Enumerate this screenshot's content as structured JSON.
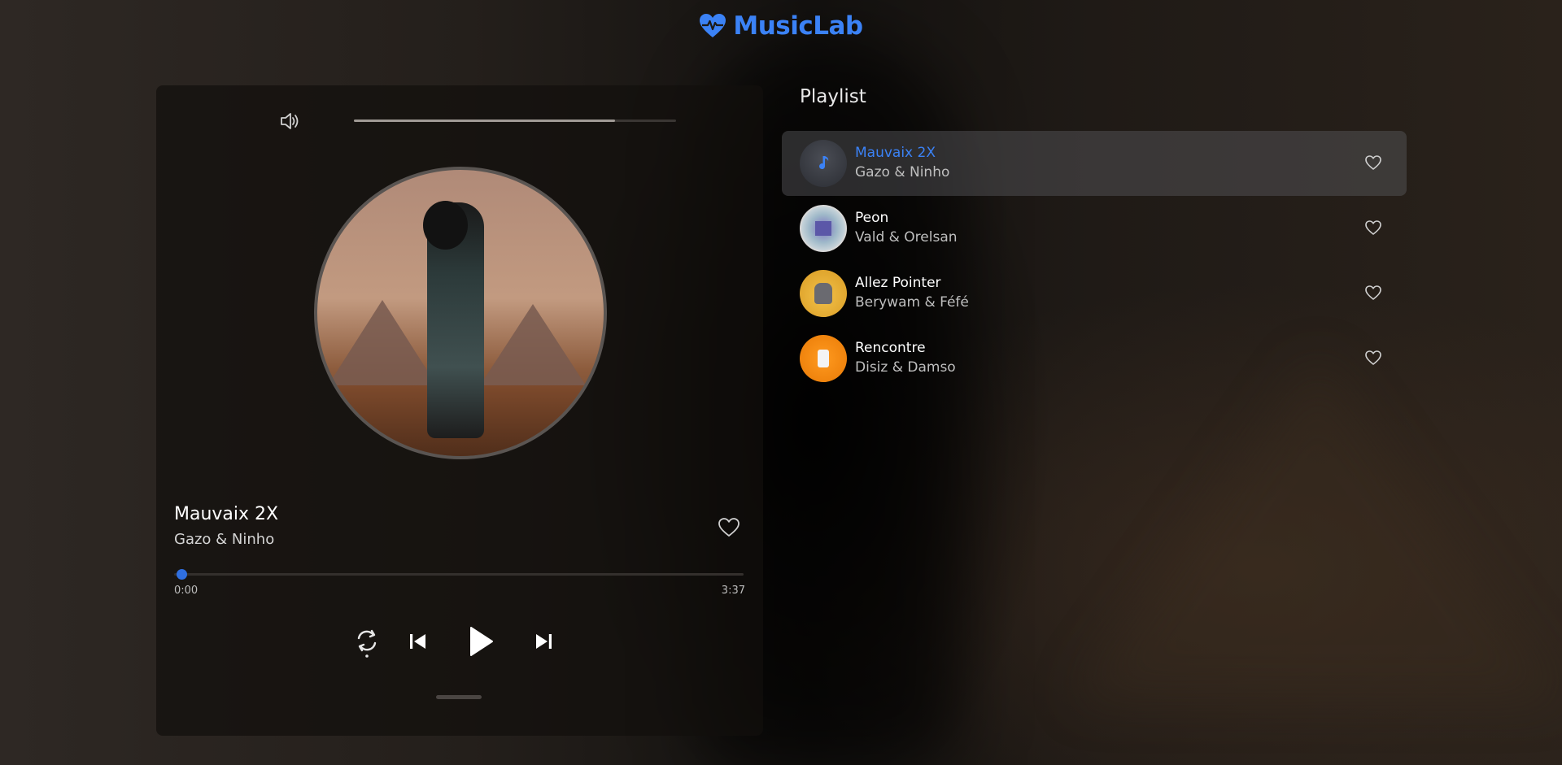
{
  "app": {
    "name": "MusicLab",
    "accent_color": "#3b82f6"
  },
  "player": {
    "volume_percent": 81,
    "title": "Mauvaix 2X",
    "artist": "Gazo & Ninho",
    "time_current": "0:00",
    "time_total": "3:37",
    "progress_percent": 0,
    "liked": false,
    "icons": {
      "volume": "volume-icon",
      "like": "heart-icon",
      "repeat": "repeat-icon",
      "previous": "skip-previous-icon",
      "play": "play-icon",
      "next": "skip-next-icon"
    }
  },
  "playlist": {
    "title": "Playlist",
    "items": [
      {
        "title": "Mauvaix 2X",
        "artist": "Gazo & Ninho",
        "active": true,
        "thumb_color": "#3a3d45"
      },
      {
        "title": "Peon",
        "artist": "Vald & Orelsan",
        "active": false,
        "thumb_color": "#9fb9c9"
      },
      {
        "title": "Allez Pointer",
        "artist": "Berywam & Féfé",
        "active": false,
        "thumb_color": "#e8b43a"
      },
      {
        "title": "Rencontre",
        "artist": "Disiz & Damso",
        "active": false,
        "thumb_color": "#f08a12"
      }
    ]
  }
}
